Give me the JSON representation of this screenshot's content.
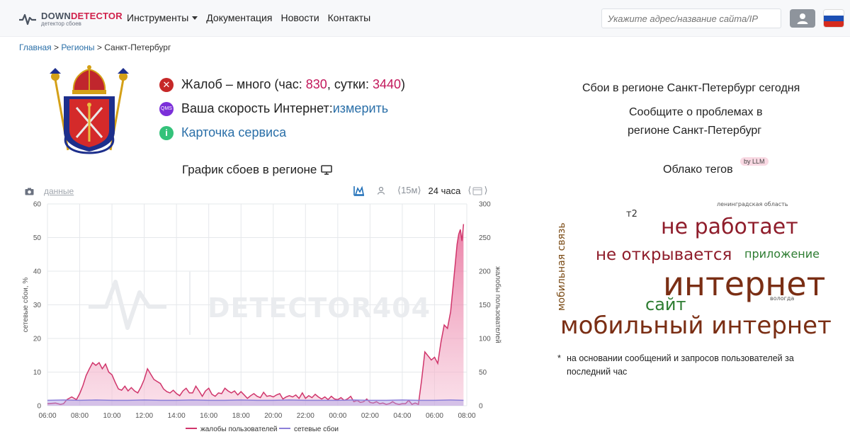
{
  "header": {
    "logo_name_part1": "DOWN",
    "logo_name_part2": "DETECTOR",
    "logo_subtitle": "детектор сбоев",
    "nav": [
      "Инструменты",
      "Документация",
      "Новости",
      "Контакты"
    ],
    "search_placeholder": "Укажите адрес/название сайта/IP"
  },
  "breadcrumb": [
    "Главная",
    "Регионы",
    "Санкт-Петербург"
  ],
  "status": {
    "complaints_label": "Жалоб – много (час: ",
    "hour_value": "830",
    "mid": ", сутки: ",
    "day_value": "3440",
    "end": ")",
    "speed_badge": "QMS",
    "speed_label": "Ваша скорость Интернет: ",
    "speed_link": "измерить",
    "card_link": "Карточка сервиса"
  },
  "chart_header": {
    "title": "График сбоев в регионе",
    "data_link": "данные",
    "interval_15m": "⟨15м⟩",
    "interval_24h": "24 часа"
  },
  "chart_data": {
    "type": "area",
    "watermark": "DETECTOR404",
    "ylabel_left": "сетевые сбои, %",
    "ylabel_right": "жалобы пользователей",
    "y_left_lim": [
      0,
      60
    ],
    "y_right_lim": [
      0,
      300
    ],
    "y_left_ticks": [
      "0",
      "10",
      "20",
      "30",
      "40",
      "50",
      "60"
    ],
    "y_right_ticks": [
      "0",
      "50",
      "100",
      "150",
      "200",
      "250",
      "300"
    ],
    "x_ticks": [
      "06:00",
      "08:00",
      "10:00",
      "12:00",
      "14:00",
      "16:00",
      "18:00",
      "20:00",
      "22:00",
      "00:00",
      "02:00",
      "04:00",
      "06:00",
      "08:00"
    ],
    "x_range_hours": [
      0,
      26
    ],
    "grid": true,
    "legend_position": "bottom",
    "series": [
      {
        "name": "жалобы пользователей",
        "axis": "right",
        "color": "#d0356b",
        "points": [
          [
            0,
            3
          ],
          [
            0.5,
            4
          ],
          [
            0.8,
            2
          ],
          [
            1.0,
            3
          ],
          [
            1.2,
            9
          ],
          [
            1.5,
            13
          ],
          [
            1.8,
            9
          ],
          [
            2.0,
            18
          ],
          [
            2.2,
            30
          ],
          [
            2.4,
            45
          ],
          [
            2.6,
            55
          ],
          [
            2.8,
            64
          ],
          [
            3.0,
            60
          ],
          [
            3.2,
            64
          ],
          [
            3.4,
            55
          ],
          [
            3.6,
            62
          ],
          [
            3.8,
            50
          ],
          [
            4.0,
            46
          ],
          [
            4.2,
            35
          ],
          [
            4.4,
            25
          ],
          [
            4.6,
            23
          ],
          [
            4.8,
            29
          ],
          [
            5.0,
            22
          ],
          [
            5.2,
            27
          ],
          [
            5.4,
            22
          ],
          [
            5.6,
            19
          ],
          [
            5.8,
            28
          ],
          [
            6.0,
            39
          ],
          [
            6.2,
            55
          ],
          [
            6.4,
            47
          ],
          [
            6.6,
            39
          ],
          [
            6.8,
            36
          ],
          [
            7.0,
            33
          ],
          [
            7.2,
            25
          ],
          [
            7.4,
            21
          ],
          [
            7.6,
            19
          ],
          [
            7.8,
            23
          ],
          [
            8.0,
            18
          ],
          [
            8.2,
            15
          ],
          [
            8.4,
            22
          ],
          [
            8.6,
            26
          ],
          [
            8.8,
            19
          ],
          [
            9.0,
            19
          ],
          [
            9.2,
            29
          ],
          [
            9.4,
            22
          ],
          [
            9.6,
            14
          ],
          [
            9.8,
            22
          ],
          [
            10.0,
            26
          ],
          [
            10.2,
            17
          ],
          [
            10.4,
            14
          ],
          [
            10.6,
            19
          ],
          [
            10.8,
            18
          ],
          [
            11.0,
            26
          ],
          [
            11.2,
            22
          ],
          [
            11.4,
            19
          ],
          [
            11.6,
            22
          ],
          [
            11.8,
            16
          ],
          [
            12.0,
            21
          ],
          [
            12.2,
            16
          ],
          [
            12.4,
            11
          ],
          [
            12.6,
            15
          ],
          [
            12.8,
            18
          ],
          [
            13.0,
            14
          ],
          [
            13.2,
            12
          ],
          [
            13.4,
            20
          ],
          [
            13.6,
            14
          ],
          [
            13.8,
            15
          ],
          [
            14.0,
            13
          ],
          [
            14.2,
            16
          ],
          [
            14.4,
            18
          ],
          [
            14.6,
            10
          ],
          [
            14.8,
            13
          ],
          [
            15.0,
            15
          ],
          [
            15.2,
            13
          ],
          [
            15.4,
            16
          ],
          [
            15.6,
            11
          ],
          [
            15.8,
            19
          ],
          [
            16.0,
            11
          ],
          [
            16.2,
            15
          ],
          [
            16.4,
            12
          ],
          [
            16.6,
            17
          ],
          [
            16.8,
            13
          ],
          [
            17.0,
            10
          ],
          [
            17.2,
            13
          ],
          [
            17.4,
            9
          ],
          [
            17.6,
            14
          ],
          [
            17.8,
            10
          ],
          [
            18.0,
            9
          ],
          [
            18.2,
            12
          ],
          [
            18.4,
            8
          ],
          [
            18.6,
            10
          ],
          [
            18.8,
            14
          ],
          [
            19.0,
            6
          ],
          [
            19.2,
            8
          ],
          [
            19.4,
            5
          ],
          [
            19.6,
            6
          ],
          [
            19.8,
            10
          ],
          [
            20.0,
            5
          ],
          [
            20.2,
            4
          ],
          [
            20.4,
            6
          ],
          [
            20.6,
            3
          ],
          [
            20.8,
            4
          ],
          [
            21.0,
            2
          ],
          [
            21.2,
            3
          ],
          [
            21.4,
            6
          ],
          [
            21.6,
            3
          ],
          [
            21.8,
            2
          ],
          [
            22.0,
            3
          ],
          [
            22.2,
            3
          ],
          [
            22.4,
            8
          ],
          [
            22.6,
            2
          ],
          [
            22.8,
            4
          ],
          [
            23.0,
            2
          ],
          [
            23.2,
            38
          ],
          [
            23.4,
            80
          ],
          [
            23.6,
            74
          ],
          [
            23.8,
            68
          ],
          [
            24.0,
            72
          ],
          [
            24.2,
            63
          ],
          [
            24.4,
            95
          ],
          [
            24.6,
            120
          ],
          [
            24.8,
            115
          ],
          [
            25.0,
            140
          ],
          [
            25.2,
            190
          ],
          [
            25.4,
            240
          ],
          [
            25.5,
            255
          ],
          [
            25.6,
            262
          ],
          [
            25.7,
            245
          ],
          [
            25.8,
            270
          ]
        ]
      },
      {
        "name": "сетевые сбои",
        "axis": "left",
        "color": "#8c7fd9",
        "points": [
          [
            0,
            1.6
          ],
          [
            1.0,
            1.7
          ],
          [
            2.0,
            1.6
          ],
          [
            3.0,
            1.7
          ],
          [
            4.0,
            1.6
          ],
          [
            5.0,
            1.6
          ],
          [
            6.0,
            1.7
          ],
          [
            7.0,
            1.6
          ],
          [
            8.0,
            1.6
          ],
          [
            9.0,
            1.7
          ],
          [
            10.0,
            1.6
          ],
          [
            11.0,
            1.6
          ],
          [
            12.0,
            1.7
          ],
          [
            13.0,
            1.6
          ],
          [
            14.0,
            1.6
          ],
          [
            15.0,
            1.7
          ],
          [
            16.0,
            1.6
          ],
          [
            17.0,
            1.6
          ],
          [
            18.0,
            1.6
          ],
          [
            19.0,
            1.7
          ],
          [
            20.0,
            1.6
          ],
          [
            21.0,
            1.6
          ],
          [
            22.0,
            1.7
          ],
          [
            23.0,
            1.6
          ],
          [
            24.0,
            1.6
          ],
          [
            25.0,
            1.7
          ],
          [
            25.8,
            1.6
          ]
        ]
      }
    ]
  },
  "right_panel": {
    "outages_title": "Сбои в регионе Санкт-Петербург сегодня",
    "report_line1": "Сообщите о проблемах в",
    "report_line2": "регионе Санкт-Петербург",
    "tags_title": "Облако тегов",
    "llm_badge": "by LLM",
    "tags": [
      {
        "text": "интернет",
        "color": "#7a2e14"
      },
      {
        "text": "мобильный интернет",
        "color": "#7a2e14"
      },
      {
        "text": "не работает",
        "color": "#8f1d2b"
      },
      {
        "text": "не открывается",
        "color": "#8f1d2b"
      },
      {
        "text": "сайт",
        "color": "#2e7d32"
      },
      {
        "text": "приложение",
        "color": "#2e7d32"
      },
      {
        "text": "мобильная связь",
        "color": "#7a4a14"
      },
      {
        "text": "т2",
        "color": "#333333"
      },
      {
        "text": "ленинградская область",
        "color": "#555555"
      },
      {
        "text": "вологда",
        "color": "#555555"
      }
    ],
    "footnote_star": "*",
    "footnote": "на основании сообщений и запросов пользователей за последний час"
  }
}
